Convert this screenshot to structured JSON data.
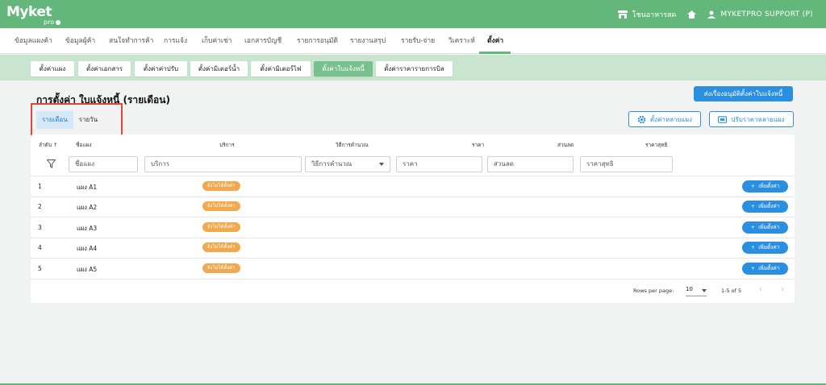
{
  "app": {
    "logo_main": "Myket",
    "logo_sub": "pro",
    "store_name": "โชนอาหารสด",
    "user_name": "MYKETPRO SUPPORT (P)"
  },
  "main_nav": [
    {
      "label": "ข้อมูลแผงค้า",
      "active": false
    },
    {
      "label": "ข้อมูลผู้ค้า",
      "active": false
    },
    {
      "label": "สนใจทำการค้า",
      "active": false
    },
    {
      "label": "การแจ้ง",
      "active": false
    },
    {
      "label": "เก็บค่าเช่า",
      "active": false
    },
    {
      "label": "เอกสารบัญชี",
      "active": false
    },
    {
      "label": "รายการอนุมัติ",
      "active": false
    },
    {
      "label": "รายงานสรุป",
      "active": false
    },
    {
      "label": "รายรับ-จ่าย",
      "active": false
    },
    {
      "label": "วิเคราะห์",
      "active": false
    },
    {
      "label": "ตั้งค่า",
      "active": true
    }
  ],
  "sub_nav": [
    {
      "label": "ตั้งค่าแผง",
      "active": false
    },
    {
      "label": "ตั้งค่าเอกสาร",
      "active": false
    },
    {
      "label": "ตั้งค่าค่าปรับ",
      "active": false
    },
    {
      "label": "ตั้งค่ามิเตอร์น้ำ",
      "active": false
    },
    {
      "label": "ตั้งค่ามิเตอร์ไฟ",
      "active": false
    },
    {
      "label": "ตั้งค่าใบแจ้งหนี้",
      "active": true
    },
    {
      "label": "ตั้งค่าราคารายการบิล",
      "active": false
    }
  ],
  "page": {
    "title": "การตั้งค่า ใบแจ้งหนี้ (รายเดือน)",
    "approve_button": "ส่งเรื่องอนุมัติตั้งค่าใบแจ้งหนี้",
    "toggle_monthly": "รายเดือน",
    "toggle_daily": "รายวัน",
    "bulk_settings_button": "ตั้งค่าหลายแผง",
    "bulk_price_button": "ปรับราคาหลายแผง"
  },
  "table": {
    "headers": {
      "order": "ลำดับ ↑",
      "stall_name": "ชื่อแผง",
      "service": "บริการ",
      "calc_method": "วิธีการคำนวณ",
      "price": "ราคา",
      "discount": "ส่วนลด",
      "net_price": "ราคาสุทธิ"
    },
    "filters": {
      "stall_name": "ชื่อแผง",
      "service": "บริการ",
      "calc_method": "วิธีการคำนวณ",
      "price": "ราคา",
      "discount": "ส่วนลด",
      "net_price": "ราคาสุทธิ"
    },
    "rows": [
      {
        "num": "1",
        "name": "แผง A1",
        "status": "ยังไม่ได้ตั้งค่า",
        "action": "เพิ่มตั้งค่า"
      },
      {
        "num": "2",
        "name": "แผง A2",
        "status": "ยังไม่ได้ตั้งค่า",
        "action": "เพิ่มตั้งค่า"
      },
      {
        "num": "3",
        "name": "แผง A3",
        "status": "ยังไม่ได้ตั้งค่า",
        "action": "เพิ่มตั้งค่า"
      },
      {
        "num": "4",
        "name": "แผง A4",
        "status": "ยังไม่ได้ตั้งค่า",
        "action": "เพิ่มตั้งค่า"
      },
      {
        "num": "5",
        "name": "แผง A5",
        "status": "ยังไม่ได้ตั้งค่า",
        "action": "เพิ่มตั้งค่า"
      }
    ]
  },
  "pagination": {
    "rows_per_page_label": "Rows per page:",
    "rows_per_page_value": "10",
    "range": "1-5 of 5"
  },
  "colors": {
    "brand_green": "#63b77b",
    "subnav_bg": "#c9e5cf",
    "primary_blue": "#2a8fe0",
    "badge_orange": "#f2a84c",
    "highlight_red": "#e5433b"
  }
}
